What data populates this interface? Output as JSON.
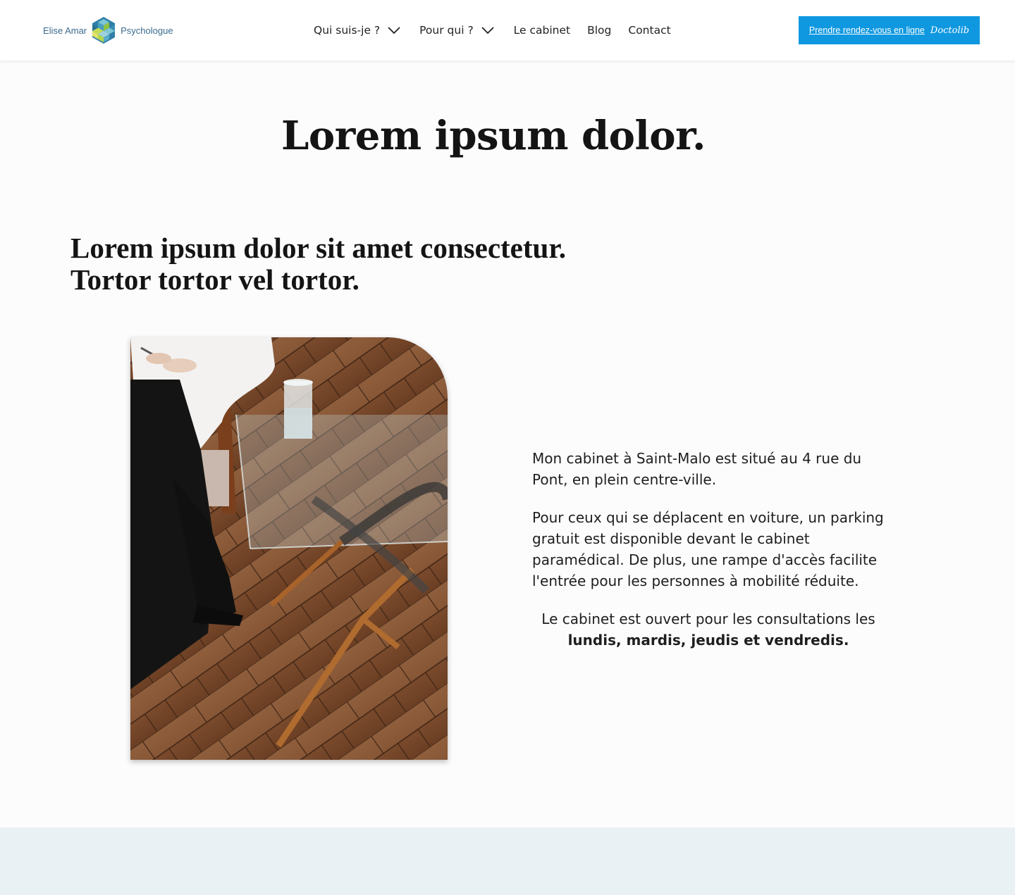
{
  "header": {
    "logo": {
      "name": "Elise Amar",
      "profession": "Psychologue",
      "icon": "cube-logo-icon"
    },
    "nav": [
      {
        "label": "Qui suis-je ?",
        "dropdown": true
      },
      {
        "label": "Pour qui ?",
        "dropdown": true
      },
      {
        "label": "Le cabinet",
        "dropdown": false
      },
      {
        "label": "Blog",
        "dropdown": false
      },
      {
        "label": "Contact",
        "dropdown": false
      }
    ],
    "cta": {
      "label": "Prendre rendez-vous en ligne",
      "brand": "Doctolib",
      "color": "#0f98e0"
    }
  },
  "main": {
    "title": "Lorem ipsum dolor.",
    "subtitle_line1": "Lorem ipsum dolor sit amet consectetur.",
    "subtitle_line2": "Tortor tortor vel tortor.",
    "photo": {
      "subject": "person seated beside glass coffee table on wooden floor"
    },
    "info": {
      "paragraph1": "Mon cabinet à Saint-Malo est situé au 4 rue du Pont, en plein centre-ville.",
      "paragraph2": "Pour ceux qui se déplacent en voiture, un parking gratuit est disponible devant le cabinet paramédical. De plus, une rampe d'accès facilite l'entrée pour les personnes à mobilité réduite.",
      "hours_intro": "Le cabinet est ouvert pour les consultations les",
      "hours_days": "lundis, mardis, jeudis et vendredis."
    }
  },
  "colors": {
    "accent": "#0f98e0",
    "band": "#e9f1f5",
    "logo_text": "#3a6a8c"
  }
}
